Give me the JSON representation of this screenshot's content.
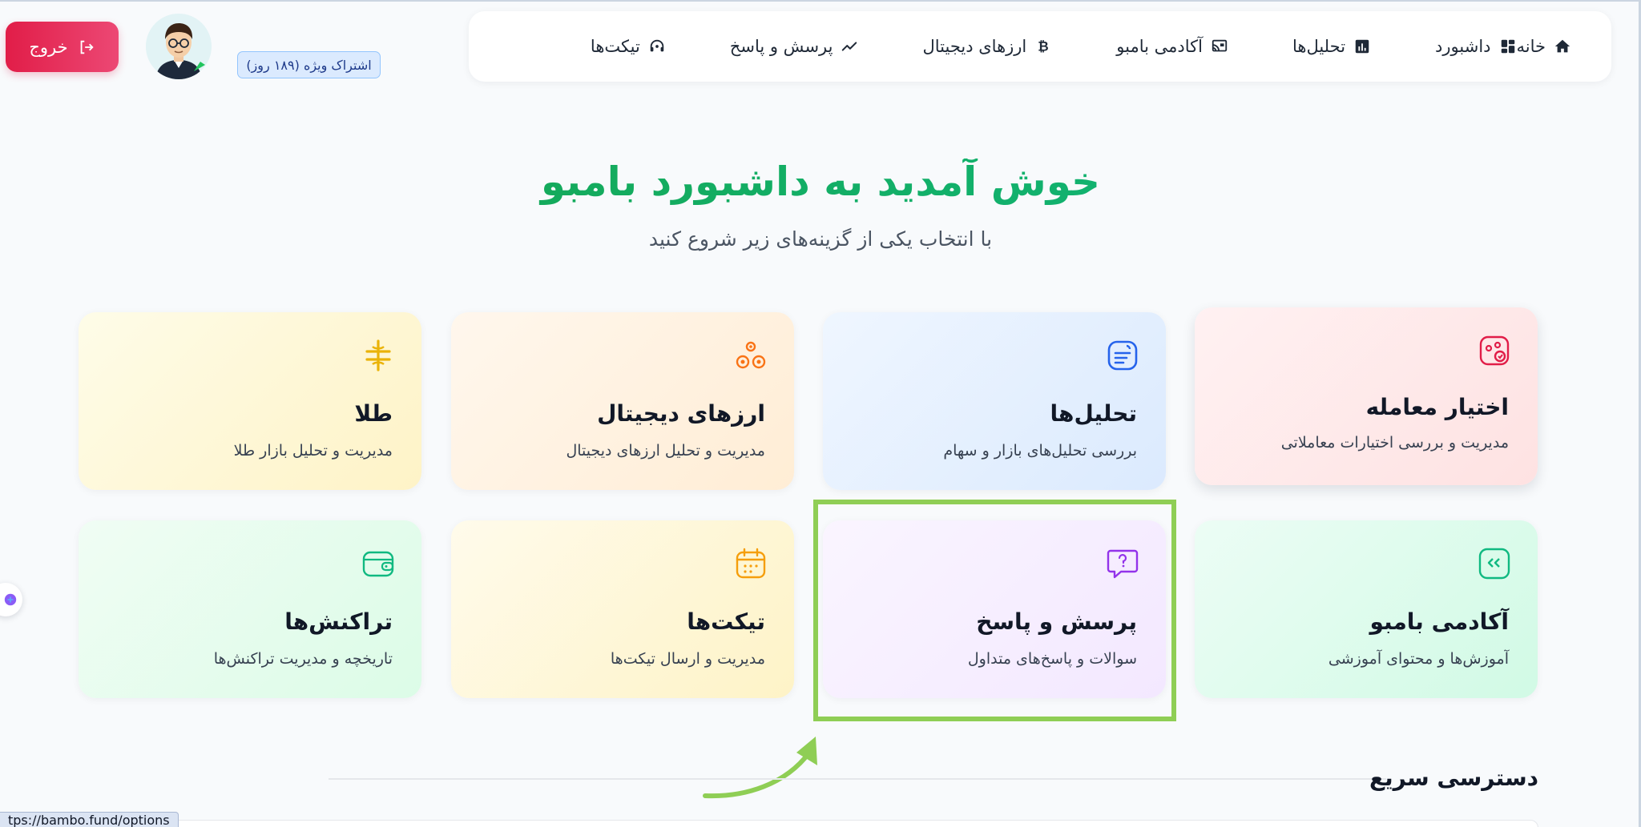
{
  "nav": {
    "items": [
      {
        "label": "خانه",
        "icon": "home-icon"
      },
      {
        "label": "داشبورد",
        "icon": "dashboard-icon"
      },
      {
        "label": "تحلیل‌ها",
        "icon": "analytics-icon"
      },
      {
        "label": "آکادمی بامبو",
        "icon": "academy-icon"
      },
      {
        "label": "ارزهای دیجیتال",
        "icon": "bitcoin-icon"
      },
      {
        "label": "پرسش و پاسخ",
        "icon": "trend-icon"
      },
      {
        "label": "تیکت‌ها",
        "icon": "support-icon"
      }
    ]
  },
  "user": {
    "logout_label": "خروج",
    "subscription_badge": "اشتراک ویژه (۱۸۹ روز)"
  },
  "hero": {
    "title": "خوش آمدید به داشبورد بامبو",
    "subtitle": "با انتخاب یکی از گزینه‌های زیر شروع کنید"
  },
  "cards": {
    "options": {
      "title": "اختیار معامله",
      "desc": "مدیریت و بررسی اختیارات معاملاتی"
    },
    "analysis": {
      "title": "تحلیل‌ها",
      "desc": "بررسی تحلیل‌های بازار و سهام"
    },
    "crypto": {
      "title": "ارزهای دیجیتال",
      "desc": "مدیریت و تحلیل ارزهای دیجیتال"
    },
    "gold": {
      "title": "طلا",
      "desc": "مدیریت و تحلیل بازار طلا"
    },
    "academy": {
      "title": "آکادمی بامبو",
      "desc": "آموزش‌ها و محتوای آموزشی"
    },
    "faq": {
      "title": "پرسش و پاسخ",
      "desc": "سوالات و پاسخ‌های متداول"
    },
    "tickets": {
      "title": "تیکت‌ها",
      "desc": "مدیریت و ارسال تیکت‌ها"
    },
    "transactions": {
      "title": "تراکنش‌ها",
      "desc": "تاریخچه و مدیریت تراکنش‌ها"
    }
  },
  "quick_access": {
    "title": "دسترسی سریع"
  },
  "status_bar": {
    "url": "tps://bambo.fund/options"
  },
  "colors": {
    "accent_green": "#16a34a",
    "logout_red": "#e11d48",
    "highlight": "#8fce55"
  }
}
